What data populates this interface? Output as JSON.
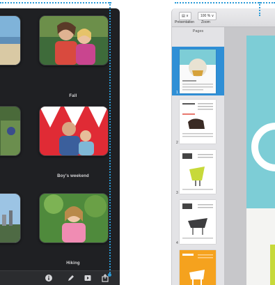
{
  "photos": {
    "albums": [
      {
        "label": ""
      },
      {
        "label": "Fall"
      },
      {
        "label": ""
      },
      {
        "label": "Boy's weekend"
      },
      {
        "label": ""
      },
      {
        "label": "Hiking"
      }
    ],
    "toolbar": {
      "info_icon": "info-icon",
      "edit_icon": "pencil-icon",
      "slideshow_icon": "slideshow-icon",
      "share_icon": "share-icon"
    }
  },
  "document": {
    "toolbar": {
      "view_button": "▤ ∨",
      "zoom_value": "100 % ∨",
      "presentation_label": "Présentation",
      "zoom_label": "Zoom"
    },
    "pages_panel": {
      "header": "Pages",
      "page_numbers": [
        "1",
        "2",
        "3",
        "4"
      ]
    }
  },
  "colors": {
    "accent": "#2a9bd8",
    "photos_bg": "#1f2023",
    "selection": "#2f8fd6",
    "slide_teal": "#7dcdd6"
  }
}
